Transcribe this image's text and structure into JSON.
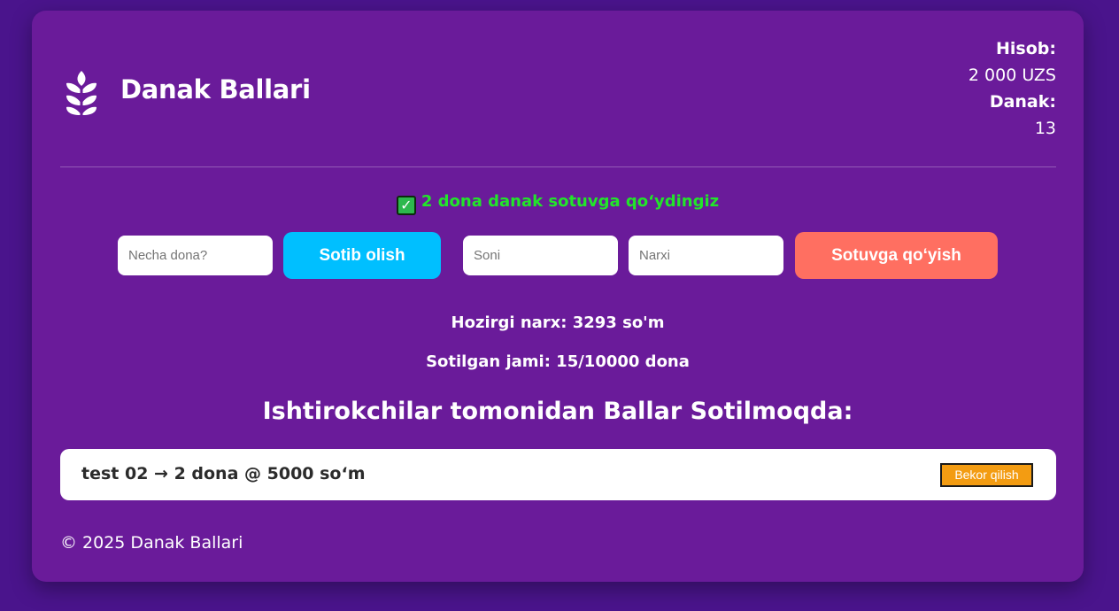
{
  "header": {
    "brand": "Danak Ballari",
    "logo_icon": "wheat-icon",
    "account": {
      "balance_label": "Hisob:",
      "balance_value": "2 000 UZS",
      "danak_label": "Danak:",
      "danak_value": "13"
    }
  },
  "message": {
    "icon": "check-icon",
    "text": "2 dona danak sotuvga qo‘ydingiz",
    "color": "#22e52a"
  },
  "buy": {
    "quantity_placeholder": "Necha dona?",
    "button_label": "Sotib olish",
    "button_color": "#00bfff"
  },
  "sell": {
    "count_placeholder": "Soni",
    "price_placeholder": "Narxi",
    "button_label": "Sotuvga qo‘yish",
    "button_color": "#ff6f61"
  },
  "stats": {
    "current_price": "Hozirgi narx: 3293 so'm",
    "sold_total": "Sotilgan jami: 15/10000 dona"
  },
  "listings": {
    "title": "Ishtirokchilar tomonidan Ballar Sotilmoqda:",
    "items": [
      {
        "text": "test 02 → 2 dona @ 5000 so‘m",
        "cancel_label": "Bekor qilish"
      }
    ]
  },
  "footer": {
    "text": "© 2025 Danak Ballari"
  },
  "colors": {
    "background": "#4a148c",
    "card": "#6a1b9a",
    "cancel": "#f39c12"
  }
}
